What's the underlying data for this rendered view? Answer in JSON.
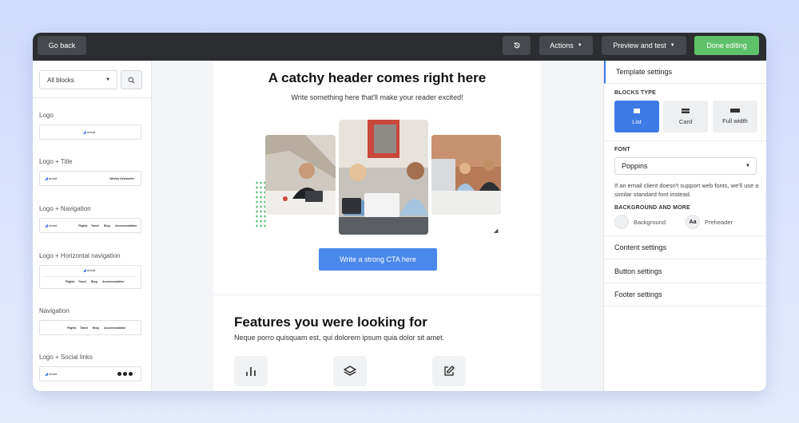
{
  "topbar": {
    "back_label": "Go back",
    "history_icon": "history-icon",
    "actions_label": "Actions",
    "preview_label": "Preview and test",
    "done_label": "Done editing",
    "colors": {
      "bar": "#2b2d30",
      "button": "#45484c",
      "done": "#5ec26a"
    }
  },
  "left_panel": {
    "filter_value": "All blocks",
    "search_icon": "search-icon",
    "blocks": [
      {
        "label": "Logo"
      },
      {
        "label": "Logo + Title",
        "thumb_text": "Weekly Newsletter"
      },
      {
        "label": "Logo + Navigation",
        "nav": [
          "Flights",
          "Travel",
          "Blog",
          "Accommodation"
        ]
      },
      {
        "label": "Logo + Horizontal navigation",
        "nav": [
          "Flights",
          "Travel",
          "Blog",
          "Accommodation"
        ]
      },
      {
        "label": "Navigation",
        "nav": [
          "Flights",
          "Travel",
          "Blog",
          "Accommodation"
        ]
      },
      {
        "label": "Logo + Social links"
      }
    ],
    "logo_text": "airmail"
  },
  "email": {
    "hero_title": "A catchy header comes right here",
    "hero_subtitle": "Write something here that'll make your reader excited!",
    "cta_label": "Write a strong CTA here",
    "features_title": "Features you were looking for",
    "features_subtitle": "Neque porro quisquam est, qui dolorem ipsum quia dolor sit amet.",
    "feature_icons": [
      "bar-chart-icon",
      "layers-icon",
      "edit-icon"
    ],
    "colors": {
      "cta": "#4a88eb",
      "dots": "#4bb86a"
    }
  },
  "right_panel": {
    "template_settings": "Template settings",
    "blocks_type_heading": "BLOCKS TYPE",
    "block_types": [
      {
        "label": "List",
        "active": true
      },
      {
        "label": "Card",
        "active": false
      },
      {
        "label": "Full width",
        "active": false
      }
    ],
    "font_heading": "FONT",
    "font_value": "Poppins",
    "font_note": "If an email client doesn't support web fonts, we'll use a similar standard font instead.",
    "background_heading": "BACKGROUND AND MORE",
    "background_label": "Background",
    "preheader_icon_text": "Aa",
    "preheader_label": "Preheader",
    "sections": [
      "Content settings",
      "Button settings",
      "Footer settings"
    ],
    "colors": {
      "accent": "#3d7ae6"
    }
  }
}
